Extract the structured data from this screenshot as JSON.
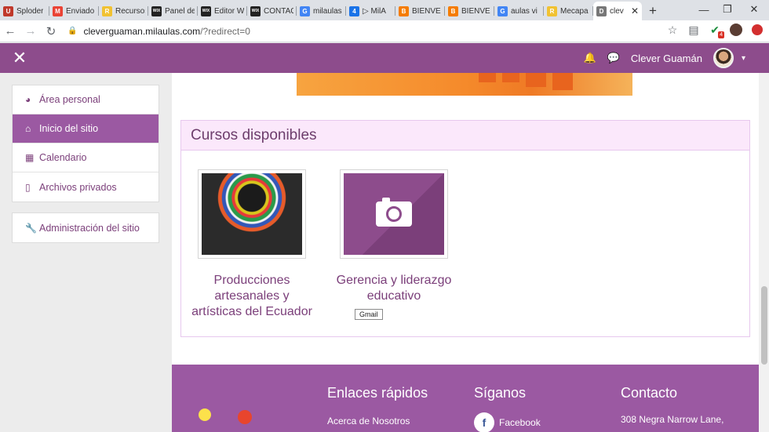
{
  "browser": {
    "tabs": [
      {
        "label": "Sploder",
        "icon": "U",
        "color": "#c0392b"
      },
      {
        "label": "Enviado",
        "icon": "M",
        "color": "#ea4335"
      },
      {
        "label": "Recursos",
        "icon": "R",
        "color": "#f1c232"
      },
      {
        "label": "Panel de",
        "icon": "WIX",
        "color": "#222222"
      },
      {
        "label": "Editor W",
        "icon": "WIX",
        "color": "#222222"
      },
      {
        "label": "CONTAC",
        "icon": "WIX",
        "color": "#222222"
      },
      {
        "label": "milaulas",
        "icon": "G",
        "color": "#4285f4"
      },
      {
        "label": "▷ MilA",
        "icon": "4",
        "color": "#1a73e8"
      },
      {
        "label": "BIENVE",
        "icon": "B",
        "color": "#f57c00"
      },
      {
        "label": "BIENVE",
        "icon": "B",
        "color": "#f57c00"
      },
      {
        "label": "aulas vi",
        "icon": "G",
        "color": "#4285f4"
      },
      {
        "label": "Mecapa",
        "icon": "R",
        "color": "#f1c232"
      },
      {
        "label": "clev",
        "icon": "D",
        "color": "#777777",
        "active": true
      }
    ],
    "new_tab": "+",
    "window_controls": [
      "—",
      "❐",
      "✕"
    ],
    "url_host": "cleverguaman.milaulas.com",
    "url_path": "/?redirect=0",
    "ext_badge": "4"
  },
  "navbar": {
    "close_symbol": "✕",
    "user_name": "Clever Guamán",
    "bell_icon": "🔔",
    "chat_icon": "💬",
    "caret": "▾"
  },
  "drawer": {
    "items": [
      {
        "label": "Área personal",
        "icon": "dashboard-icon",
        "glyph": "◕"
      },
      {
        "label": "Inicio del sitio",
        "icon": "home-icon",
        "glyph": "⌂",
        "active": true
      },
      {
        "label": "Calendario",
        "icon": "calendar-icon",
        "glyph": "▦"
      },
      {
        "label": "Archivos privados",
        "icon": "file-icon",
        "glyph": "▯"
      }
    ],
    "admin": {
      "label": "Administración del sitio",
      "icon": "wrench-icon",
      "glyph": "🔧"
    }
  },
  "courses": {
    "heading": "Cursos disponibles",
    "items": [
      {
        "title": "Producciones artesanales y artísticas del Ecuador"
      },
      {
        "title": "Gerencia y liderazgo educativo"
      }
    ],
    "tooltip": "Gmail"
  },
  "footer": {
    "col1_title": "Enlaces rápidos",
    "col1_link": "Acerca de Nosotros",
    "col2_title": "Síganos",
    "col2_link": "Facebook",
    "col3_title": "Contacto",
    "col3_line": "308 Negra Narrow Lane,"
  }
}
